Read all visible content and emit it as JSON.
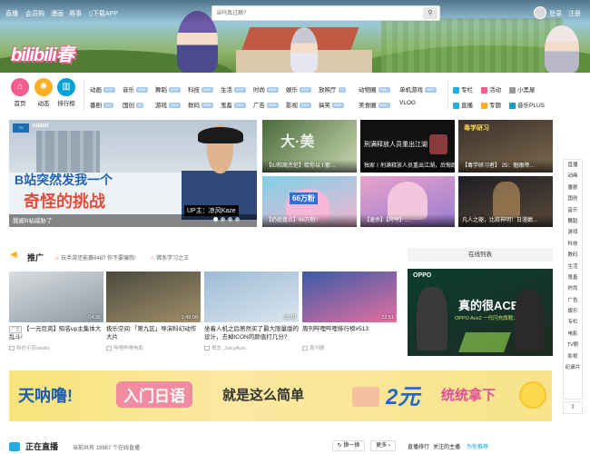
{
  "topnav": {
    "links": [
      "直播",
      "会员购",
      "漫画",
      "赛事",
      "下载APP"
    ],
    "search_placeholder": "当吗真过瘾?",
    "search_icon": "search-icon",
    "login": "登录",
    "register": "注册"
  },
  "logo": {
    "text": "bilibili春"
  },
  "primary_cats": [
    {
      "label": "首页",
      "color": "#f25d8e",
      "icon": "home-icon"
    },
    {
      "label": "动态",
      "color": "#ffb027",
      "icon": "sun-icon"
    },
    {
      "label": "排行榜",
      "color": "#00a1d6",
      "icon": "chart-icon"
    }
  ],
  "categories_row1": [
    {
      "label": "动画",
      "badge": "999+"
    },
    {
      "label": "音乐",
      "badge": "999+"
    },
    {
      "label": "舞蹈",
      "badge": "999+"
    },
    {
      "label": "科技",
      "badge": "999+"
    },
    {
      "label": "生活",
      "badge": "999+"
    },
    {
      "label": "时尚",
      "badge": "999+"
    },
    {
      "label": "娱乐",
      "badge": "999+"
    },
    {
      "label": "放映厅",
      "badge": "71"
    },
    {
      "label": "动物圈",
      "badge": "999+"
    },
    {
      "label": "单机游戏",
      "badge": "999+"
    }
  ],
  "categories_row2": [
    {
      "label": "番剧",
      "badge": "130"
    },
    {
      "label": "国创",
      "badge": "95"
    },
    {
      "label": "游戏",
      "badge": "999+"
    },
    {
      "label": "数码",
      "badge": "999+"
    },
    {
      "label": "鬼畜",
      "badge": "999+"
    },
    {
      "label": "广告",
      "badge": "999+"
    },
    {
      "label": "影视",
      "badge": "999+"
    },
    {
      "label": "搞笑",
      "badge": "999+"
    },
    {
      "label": "美食圈",
      "badge": "999+"
    },
    {
      "label": "VLOG",
      "badge": ""
    }
  ],
  "right_cats": [
    {
      "label": "专栏",
      "color": "#23ade5"
    },
    {
      "label": "活动",
      "color": "#f25d8e"
    },
    {
      "label": "小黑屋",
      "color": "#999999"
    },
    {
      "label": "直播",
      "color": "#23ade5"
    },
    {
      "label": "专题",
      "color": "#ffb027"
    },
    {
      "label": "音乐PLUS",
      "color": "#00a1d6"
    }
  ],
  "hero": {
    "badge": "B站",
    "headline1": "B站突然发我一个",
    "headline2": "奇怪的挑战",
    "name_tag": "UP主：凉风Kaze",
    "caption": "我被B站威胁了"
  },
  "feature_cards": [
    {
      "caption": "【IU和周杰伦】给你以 I 那…"
    },
    {
      "caption": "刑满释放人员重出江湖"
    },
    {
      "caption": "【毒学研习者】 25：魁眼帝…"
    },
    {
      "caption": "【奶姐盘点】66万粉！"
    },
    {
      "caption": "【速杀】【阿夸】…"
    },
    {
      "caption": "凡人之躯，比肩神明！日漫巅…"
    }
  ],
  "feature_subcaptions": [
    "独家丨刑满释放人员重出江湖，后悔跑吧…"
  ],
  "promo": {
    "title": "推广",
    "hot1": "玩手游还能赢648? 你不要骗我!",
    "hot2": "佛系学习之王",
    "ranking_label": "在线列表"
  },
  "videos": [
    {
      "duration": "04:35",
      "tag": "广告",
      "title": "【一元巨资】知名up主集体大乱斗!",
      "up": "特伦小苏studio"
    },
    {
      "duration": "1:49:08",
      "tag": "",
      "title": "极乐空间:「第九区」导演科幻动作大片",
      "up": "哔哩哔哩电影"
    },
    {
      "duration": "18:19",
      "tag": "",
      "title": "坐着人机之后居然买了最大限量版的设计，去掉ICON的颜值打几分?",
      "up": "视车_JuicyAuto"
    },
    {
      "duration": "22:51",
      "tag": "",
      "title": "周刊哔哩哔哩排行榜#513",
      "up": "周刊娘"
    }
  ],
  "ad_right": {
    "brand": "OPPO",
    "headline": "真的很ACE",
    "sub": "OPPO Ace2 一代闪充旗舰大作战"
  },
  "ad_banner": {
    "part1": "天呐噜!",
    "part2": "入门日语",
    "part3": "就是这么简单",
    "part4": "2元",
    "part5": "统统拿下"
  },
  "live": {
    "title": "正在直播",
    "count": "当前共有 19987 个在线直播",
    "refresh": "换一换",
    "more": "更多",
    "rank": "直播排行",
    "follow": "关注的主播",
    "recommend": "为你推荐"
  },
  "sidebar": [
    "直播",
    "动画",
    "番剧",
    "国创",
    "音乐",
    "舞蹈",
    "游戏",
    "科技",
    "数码",
    "生活",
    "鬼畜",
    "时尚",
    "广告",
    "娱乐",
    "专栏",
    "电影",
    "TV剧",
    "影视",
    "纪录片"
  ],
  "sidebar_bottom": {
    "top": "⇧"
  }
}
